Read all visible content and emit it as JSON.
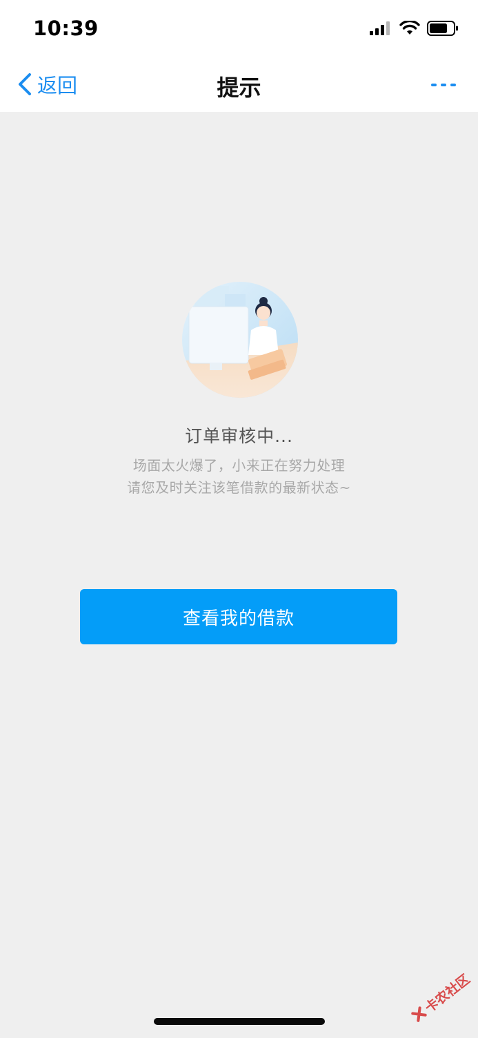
{
  "status_bar": {
    "time": "10:39"
  },
  "nav": {
    "back_label": "返回",
    "title": "提示"
  },
  "content": {
    "status_title": "订单审核中...",
    "desc_line_1": "场面太火爆了，小来正在努力处理",
    "desc_line_2": "请您及时关注该笔借款的最新状态~"
  },
  "actions": {
    "view_loans_label": "查看我的借款"
  },
  "watermark": {
    "text": "卡农社区"
  },
  "icons": {
    "back": "chevron-left-icon",
    "more": "more-dots-icon",
    "signal": "cellular-signal-icon",
    "wifi": "wifi-icon",
    "battery": "battery-icon"
  },
  "colors": {
    "accent": "#1b8df0",
    "button": "#049df8",
    "background": "#efefef"
  }
}
